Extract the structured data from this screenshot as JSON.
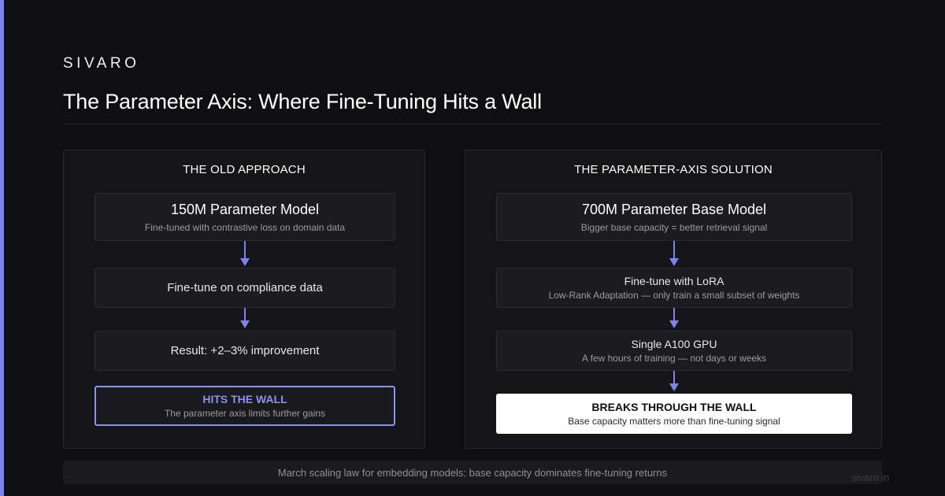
{
  "brand": "SIVARO",
  "title": "The Parameter Axis: Where Fine-Tuning Hits a Wall",
  "colors": {
    "accent": "#7c83f0",
    "background": "#0f0f11",
    "panel": "#151517"
  },
  "left_panel": {
    "heading": "THE OLD APPROACH",
    "boxes": [
      {
        "main": "150M Parameter Model",
        "sub": "Fine-tuned with contrastive loss on domain data"
      },
      {
        "main": "Fine-tune on compliance data"
      },
      {
        "main": "Result: +2–3% improvement"
      },
      {
        "main": "HITS THE WALL",
        "sub": "The parameter axis limits further gains"
      }
    ]
  },
  "right_panel": {
    "heading": "THE PARAMETER-AXIS SOLUTION",
    "boxes": [
      {
        "main": "700M Parameter Base Model",
        "sub": "Bigger base capacity = better retrieval signal"
      },
      {
        "main": "Fine-tune with LoRA",
        "sub": "Low-Rank Adaptation — only train a small subset of weights"
      },
      {
        "main": "Single A100 GPU",
        "sub": "A few hours of training — not days or weeks"
      },
      {
        "main": "BREAKS THROUGH THE WALL",
        "sub": "Base capacity matters more than fine-tuning signal"
      }
    ]
  },
  "footer": "March scaling law for embedding models: base capacity dominates fine-tuning returns",
  "domain": "sivaro.in",
  "icons": {
    "flow_arrow": "arrow-down-icon"
  }
}
